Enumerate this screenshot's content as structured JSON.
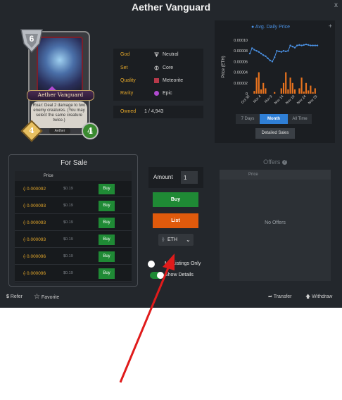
{
  "window": {
    "title": "Aether Vanguard",
    "close_label": "x"
  },
  "card": {
    "name": "Aether Vanguard",
    "mana": "6",
    "attack": "4",
    "health": "4",
    "text": "Roar: Deal 2 damage to two enemy creatures. (You may select the same creature twice.)",
    "tribe": "Aether"
  },
  "info": {
    "rows": [
      {
        "key": "God",
        "value": "Neutral",
        "icon": "neutral-god-icon"
      },
      {
        "key": "Set",
        "value": "Core",
        "icon": "core-set-icon"
      },
      {
        "key": "Quality",
        "value": "Meteorite",
        "icon": "meteorite-quality-icon",
        "color": "#b8394a"
      },
      {
        "key": "Rarity",
        "value": "Epic",
        "icon": "epic-rarity-icon",
        "color": "#b04ad0"
      }
    ],
    "owned_key": "Owned",
    "owned_value": "1 / 4,943"
  },
  "chart_data": {
    "type": "line",
    "title": "",
    "legend": [
      "Avg. Daily Price"
    ],
    "ylabel": "Price (ETH)",
    "xlabel": "",
    "yticks": [
      "0.00010",
      "0.00008",
      "0.00006",
      "0.00004",
      "0.00002",
      "0"
    ],
    "ylim": [
      0,
      0.0001
    ],
    "xticks": [
      "Oct 30",
      "Nov 4",
      "Nov 9",
      "Nov 14",
      "Nov 19",
      "Nov 24",
      "Nov 29"
    ],
    "x": [
      "Oct 30",
      "Oct 31",
      "Nov 1",
      "Nov 2",
      "Nov 3",
      "Nov 4",
      "Nov 5",
      "Nov 6",
      "Nov 7",
      "Nov 8",
      "Nov 9",
      "Nov 10",
      "Nov 11",
      "Nov 12",
      "Nov 13",
      "Nov 14",
      "Nov 15",
      "Nov 16",
      "Nov 17",
      "Nov 18",
      "Nov 19",
      "Nov 20",
      "Nov 21",
      "Nov 22",
      "Nov 23",
      "Nov 24",
      "Nov 25",
      "Nov 26",
      "Nov 27",
      "Nov 28",
      "Nov 29"
    ],
    "series": [
      {
        "name": "Avg. Daily Price",
        "kind": "line",
        "color": "#4a90e2",
        "values": [
          7.5e-05,
          8.5e-05,
          8.2e-05,
          8e-05,
          7.8e-05,
          7.5e-05,
          7.2e-05,
          7e-05,
          6.6e-05,
          6.2e-05,
          6e-05,
          6.8e-05,
          8e-05,
          7.9e-05,
          7.8e-05,
          8e-05,
          7.9e-05,
          8e-05,
          9e-05,
          8.8e-05,
          8.6e-05,
          9e-05,
          9.1e-05,
          9e-05,
          9.1e-05,
          9.2e-05,
          9.1e-05,
          9e-05,
          9e-05,
          9e-05,
          9e-05
        ]
      },
      {
        "name": "",
        "kind": "bar",
        "color": "#e8731e",
        "values": [
          0,
          0,
          5e-06,
          3e-05,
          4e-05,
          8e-06,
          2e-05,
          1e-05,
          0,
          0,
          0,
          3e-06,
          0,
          0,
          1e-05,
          2e-05,
          4e-05,
          8e-06,
          3e-05,
          2e-05,
          8e-06,
          0,
          1e-05,
          3e-05,
          4e-06,
          2e-05,
          6e-06,
          1.5e-05,
          3e-06,
          1e-05,
          0
        ]
      }
    ],
    "ranges": [
      "7 Days",
      "Month",
      "All Time"
    ],
    "active_range": "Month",
    "details_label": "Detailed Sales"
  },
  "for_sale": {
    "title": "For Sale",
    "column_price": "Price",
    "rows": [
      {
        "price": "0.000092",
        "usd": "$0.19",
        "buy": "Buy"
      },
      {
        "price": "0.000093",
        "usd": "$0.19",
        "buy": "Buy"
      },
      {
        "price": "0.000093",
        "usd": "$0.19",
        "buy": "Buy"
      },
      {
        "price": "0.000093",
        "usd": "$0.19",
        "buy": "Buy"
      },
      {
        "price": "0.000096",
        "usd": "$0.19",
        "buy": "Buy"
      },
      {
        "price": "0.000096",
        "usd": "$0.19",
        "buy": "Buy"
      }
    ]
  },
  "controls": {
    "amount_label": "Amount",
    "amount_value": "1",
    "buy_label": "Buy",
    "list_label": "List",
    "currency": "ETH",
    "my_listings_label": "My Listings Only",
    "show_details_label": "Show Details",
    "my_listings_on": false,
    "show_details_on": true
  },
  "offers": {
    "title": "Offers",
    "column_price": "Price",
    "empty": "No Offers"
  },
  "footer": {
    "refer": "Refer",
    "favorite": "Favorite",
    "transfer": "Transfer",
    "withdraw": "Withdraw"
  },
  "colors": {
    "panel": "#23272c",
    "accent_gold": "#e4a72a",
    "buy_green": "#1f8a35",
    "list_orange": "#e05a0c",
    "link_blue": "#2f7fd6",
    "arrow_red": "#e01b1b"
  }
}
